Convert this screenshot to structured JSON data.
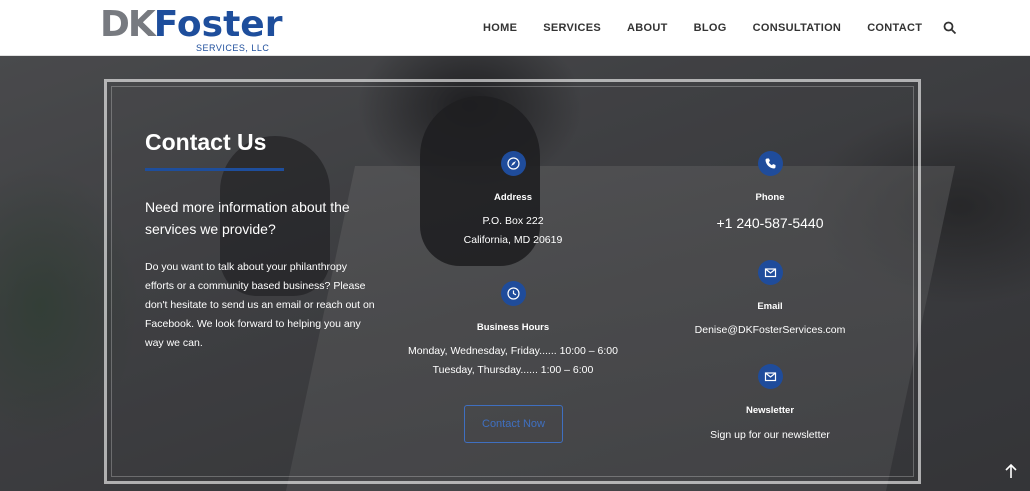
{
  "logo": {
    "mark_prefix": "DK",
    "mark_name": "Foster",
    "sub": "SERVICES, LLC"
  },
  "nav": {
    "items": [
      "HOME",
      "SERVICES",
      "ABOUT",
      "BLOG",
      "CONSULTATION",
      "CONTACT"
    ],
    "search_icon": "search-icon"
  },
  "contact": {
    "title": "Contact Us",
    "subhead": "Need more information about the services we provide?",
    "body": "Do you want to talk about your philanthropy efforts or a community based business? Please don't hesitate to send us an email or reach out on Facebook. We look forward to helping you any way we can."
  },
  "address": {
    "icon": "compass-icon",
    "label": "Address",
    "line1": "P.O. Box 222",
    "line2": "California, MD 20619"
  },
  "hours": {
    "icon": "clock-icon",
    "label": "Business Hours",
    "line1": "Monday, Wednesday, Friday...... 10:00 – 6:00",
    "line2": "Tuesday, Thursday...... 1:00 – 6:00"
  },
  "phone": {
    "icon": "phone-icon",
    "label": "Phone",
    "value": "+1 240-587-5440"
  },
  "email": {
    "icon": "mail-icon",
    "label": "Email",
    "value": "Denise@DKFosterServices.com"
  },
  "newsletter": {
    "icon": "mail-icon",
    "label": "Newsletter",
    "value": "Sign up for our newsletter"
  },
  "cta": {
    "label": "Contact Now"
  },
  "colors": {
    "brand_blue": "#1e4e9c",
    "brand_gray": "#777a80"
  }
}
